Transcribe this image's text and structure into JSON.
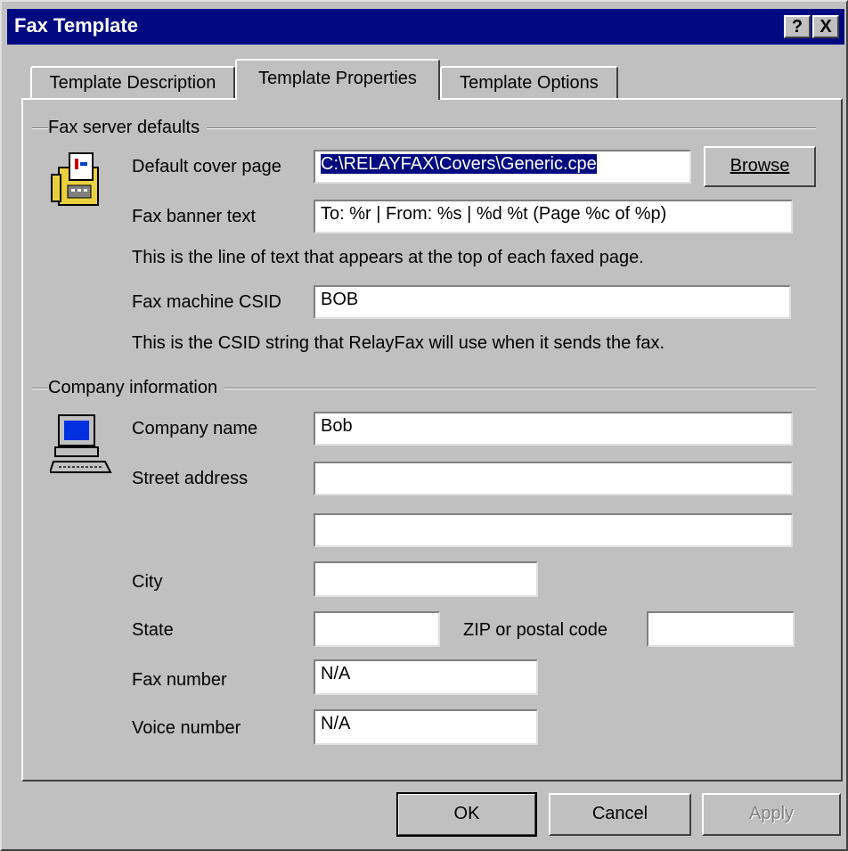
{
  "window": {
    "title": "Fax Template",
    "help_glyph": "?",
    "close_glyph": "X"
  },
  "tabs": [
    {
      "label": "Template Description"
    },
    {
      "label": "Template Properties"
    },
    {
      "label": "Template Options"
    }
  ],
  "fax_defaults": {
    "group_label": "Fax server defaults",
    "cover_page_label": "Default cover page",
    "cover_page_value": "C:\\RELAYFAX\\Covers\\Generic.cpe",
    "browse_label": "Browse",
    "banner_label": "Fax banner text",
    "banner_value": "To: %r | From: %s | %d %t  (Page %c of %p)",
    "banner_hint": "This is the line of text that appears at the top of each faxed page.",
    "csid_label": "Fax machine CSID",
    "csid_value": "BOB",
    "csid_hint": "This is the CSID string that RelayFax will use when it sends the fax.",
    "icon": "fax-machine-icon"
  },
  "company": {
    "group_label": "Company information",
    "name_label": "Company name",
    "name_value": "Bob",
    "street_label": "Street address",
    "street_value_1": "",
    "street_value_2": "",
    "city_label": "City",
    "city_value": "",
    "state_label": "State",
    "state_value": "",
    "zip_label": "ZIP or postal code",
    "zip_value": "",
    "fax_label": "Fax number",
    "fax_value": "N/A",
    "voice_label": "Voice number",
    "voice_value": "N/A",
    "icon": "computer-icon"
  },
  "footer": {
    "ok": "OK",
    "cancel": "Cancel",
    "apply": "Apply"
  },
  "colors": {
    "titlebar": "#000a80",
    "face": "#c0c0c0",
    "selection": "#000a80"
  }
}
